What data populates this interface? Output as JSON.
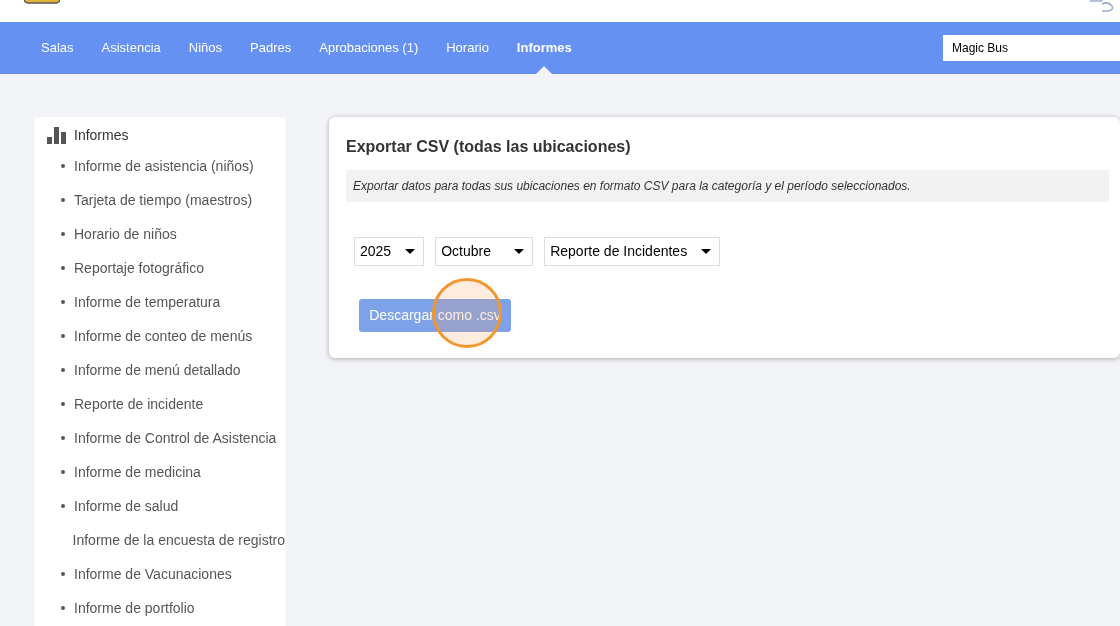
{
  "nav": {
    "tabs": [
      {
        "label": "Salas",
        "selected": false
      },
      {
        "label": "Asistencia",
        "selected": false
      },
      {
        "label": "Niños",
        "selected": false
      },
      {
        "label": "Padres",
        "selected": false
      },
      {
        "label": "Aprobaciones (1)",
        "selected": false
      },
      {
        "label": "Horario",
        "selected": false
      },
      {
        "label": "Informes",
        "selected": true
      }
    ],
    "location_field": {
      "value": "Magic Bus"
    }
  },
  "sidebar": {
    "title": "Informes",
    "items": [
      {
        "label": "Informe de asistencia (niños)",
        "bullet": true
      },
      {
        "label": "Tarjeta de tiempo (maestros)",
        "bullet": true
      },
      {
        "label": "Horario de niños",
        "bullet": true
      },
      {
        "label": "Reportaje fotográfico",
        "bullet": true
      },
      {
        "label": "Informe de temperatura",
        "bullet": true
      },
      {
        "label": "Informe de conteo de menús",
        "bullet": true
      },
      {
        "label": "Informe de menú detallado",
        "bullet": true
      },
      {
        "label": "Reporte de incidente",
        "bullet": true
      },
      {
        "label": "Informe de Control de Asistencia",
        "bullet": true
      },
      {
        "label": "Informe de medicina",
        "bullet": true
      },
      {
        "label": "Informe de salud",
        "bullet": true
      },
      {
        "label": "Informe de la encuesta de registro",
        "bullet": false
      },
      {
        "label": "Informe de Vacunaciones",
        "bullet": true
      },
      {
        "label": "Informe de portfolio",
        "bullet": true
      }
    ]
  },
  "export_card": {
    "title": "Exportar CSV (todas las ubicaciones)",
    "description": "Exportar datos para todas sus ubicaciones en formato CSV para la categoría y el período seleccionados.",
    "selects": [
      {
        "value": "2025"
      },
      {
        "value": "Octubre"
      },
      {
        "value": "Reporte de Incidentes"
      }
    ],
    "download_button": "Descargar como .csv"
  }
}
